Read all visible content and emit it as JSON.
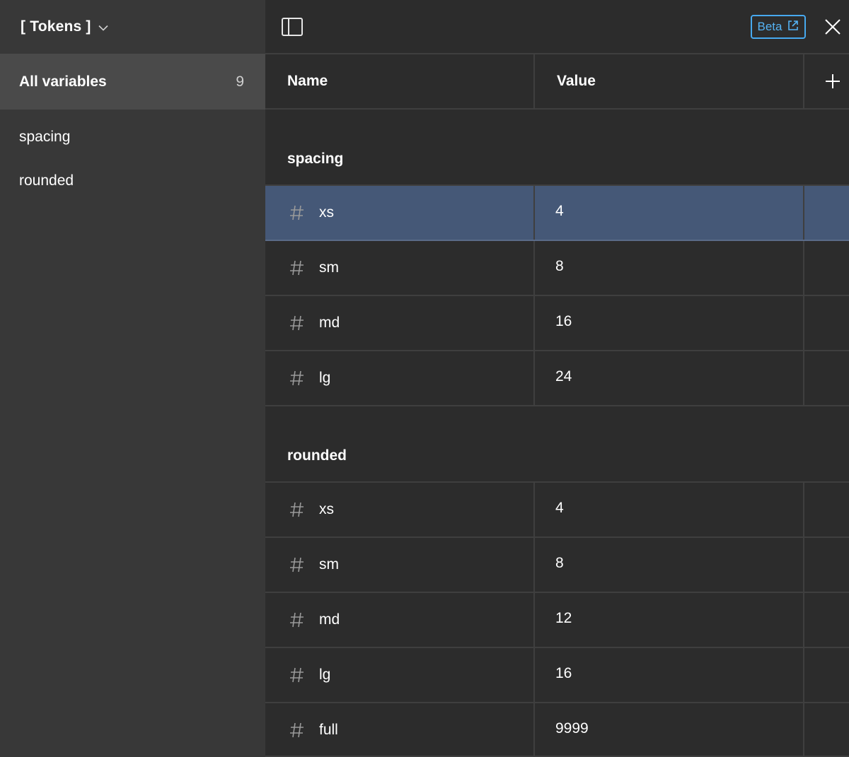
{
  "sidebar": {
    "collection_title": "[ Tokens ]",
    "all_label": "All variables",
    "all_count": "9",
    "groups": [
      "spacing",
      "rounded"
    ]
  },
  "toolbar": {
    "beta_label": "Beta"
  },
  "table": {
    "name_header": "Name",
    "value_header": "Value",
    "groups": [
      {
        "label": "spacing",
        "rows": [
          {
            "name": "xs",
            "value": "4"
          },
          {
            "name": "sm",
            "value": "8"
          },
          {
            "name": "md",
            "value": "16"
          },
          {
            "name": "lg",
            "value": "24"
          }
        ]
      },
      {
        "label": "rounded",
        "rows": [
          {
            "name": "xs",
            "value": "4"
          },
          {
            "name": "sm",
            "value": "8"
          },
          {
            "name": "md",
            "value": "12"
          },
          {
            "name": "lg",
            "value": "16"
          },
          {
            "name": "full",
            "value": "9999"
          }
        ]
      }
    ]
  },
  "colors": {
    "sidebar_bg": "#383838",
    "sidebar_selected_bg": "#4a4a4a",
    "main_bg": "#2c2c2c",
    "row_selected_bg": "#455877",
    "accent": "#55b4f5"
  },
  "icons": {
    "collection": "chevron-down-icon",
    "sidebar_toggle": "sidebar-panel-icon",
    "beta": "external-link-icon",
    "close": "close-icon",
    "add": "plus-icon",
    "variable": "number-hash-icon"
  }
}
